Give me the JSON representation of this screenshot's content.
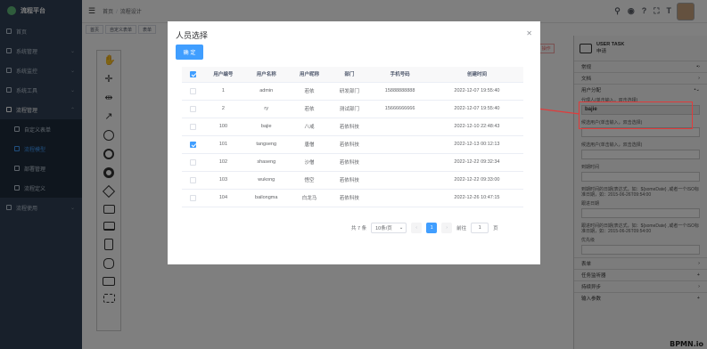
{
  "app": {
    "name": "流程平台"
  },
  "sidebar": {
    "items": [
      {
        "label": "首页",
        "icon": "home-icon"
      },
      {
        "label": "系统管理",
        "icon": "gear-icon"
      },
      {
        "label": "系统监控",
        "icon": "monitor-icon"
      },
      {
        "label": "系统工具",
        "icon": "tool-icon"
      },
      {
        "label": "流程管理",
        "icon": "flow-icon"
      }
    ],
    "subitems": [
      {
        "label": "自定义表单",
        "icon": "form-icon"
      },
      {
        "label": "流程模型",
        "icon": "model-icon"
      },
      {
        "label": "部署管理",
        "icon": "deploy-icon"
      },
      {
        "label": "流程定义",
        "icon": "definition-icon"
      }
    ],
    "last": {
      "label": "流程使用",
      "icon": "use-icon"
    }
  },
  "topbar": {
    "breadcrumb": [
      "首页",
      "流程设计"
    ],
    "icons": [
      "search-icon",
      "github-icon",
      "question-icon",
      "fullscreen-icon",
      "font-size-icon"
    ]
  },
  "tags": [
    "首页",
    "自定义表单",
    "表单"
  ],
  "palette": [
    "hand-tool-icon",
    "lasso-icon",
    "space-tool-icon",
    "connect-icon",
    "start-event-icon",
    "intermediate-event-icon",
    "end-event-icon",
    "gateway-icon",
    "task-icon",
    "subprocess-icon",
    "data-object-icon",
    "data-store-icon",
    "pool-icon",
    "group-icon"
  ],
  "operation_tag": "⊟ 操作",
  "right_panel": {
    "title": "USER TASK",
    "subtitle": "申请",
    "groups_top": [
      "常规",
      "文档",
      "用户分配"
    ],
    "assignee_label": "代理人(单击输入，双击选择)",
    "assignee_value": "bajie",
    "candidate_users_label": "候选用户(单击输入，双击选择)",
    "candidate_users_label2": "候选用户(单击输入，双击选择)",
    "due_date_label": "到期时间",
    "due_date_hint": "到期时间的日期(表达式，如：${someDate} ,或者一个ISO标准日期，如：2015-06-26T09:54:00",
    "follow_up_label": "跟进日期",
    "follow_up_hint": "跟进时间的日期(表达式，如：${someDate} ,或者一个ISO标准日期，如：2015-06-26T09:54:00",
    "priority_label": "优先级",
    "groups_bottom": [
      "表单",
      "任务监听器",
      "持续异步",
      "输入参数"
    ],
    "logo": "BPMN.io"
  },
  "dialog": {
    "title": "人员选择",
    "confirm_label": "确 定",
    "columns": [
      "用户编号",
      "用户名称",
      "用户昵称",
      "部门",
      "手机号码",
      "创建时间"
    ],
    "rows": [
      {
        "checked": false,
        "id": "1",
        "username": "admin",
        "nickname": "若依",
        "dept": "研发部门",
        "phone": "15888888888",
        "created": "2022-12-07 19:55:40"
      },
      {
        "checked": false,
        "id": "2",
        "username": "ry",
        "nickname": "若依",
        "dept": "测试部门",
        "phone": "15666666666",
        "created": "2022-12-07 19:55:40"
      },
      {
        "checked": false,
        "id": "100",
        "username": "bajie",
        "nickname": "八戒",
        "dept": "若依科技",
        "phone": "",
        "created": "2022-12-10 22:48:43"
      },
      {
        "checked": true,
        "id": "101",
        "username": "tangseng",
        "nickname": "唐僧",
        "dept": "若依科技",
        "phone": "",
        "created": "2022-12-13 00:12:13"
      },
      {
        "checked": false,
        "id": "102",
        "username": "shaseng",
        "nickname": "沙僧",
        "dept": "若依科技",
        "phone": "",
        "created": "2022-12-22 09:32:34"
      },
      {
        "checked": false,
        "id": "103",
        "username": "wukong",
        "nickname": "悟空",
        "dept": "若依科技",
        "phone": "",
        "created": "2022-12-22 09:33:00"
      },
      {
        "checked": false,
        "id": "104",
        "username": "bailongma",
        "nickname": "白龙马",
        "dept": "若依科技",
        "phone": "",
        "created": "2022-12-26 10:47:15"
      }
    ],
    "pager": {
      "total": "共 7 条",
      "page_size": "10条/页",
      "current_page": "1",
      "goto_label": "前往",
      "goto_value": "1",
      "page_suffix": "页"
    }
  },
  "colors": {
    "primary": "#409eff",
    "sidebar": "#304156",
    "annotation": "#e23b3b"
  }
}
